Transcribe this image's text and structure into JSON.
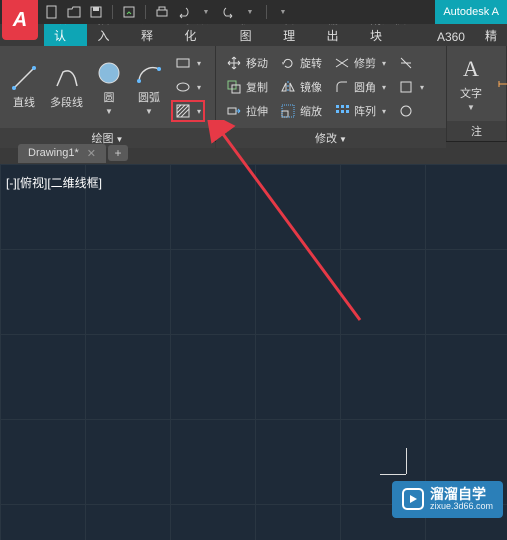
{
  "app": {
    "logo": "A",
    "title": "Autodesk A"
  },
  "tabs": [
    "默认",
    "插入",
    "注释",
    "参数化",
    "视图",
    "管理",
    "输出",
    "附加模块",
    "A360",
    "精"
  ],
  "activeTab": "默认",
  "panels": {
    "draw": {
      "title": "绘图",
      "tools": {
        "line": "直线",
        "polyline": "多段线",
        "circle": "圆",
        "arc": "圆弧"
      }
    },
    "modify": {
      "title": "修改",
      "tools": {
        "move": "移动",
        "rotate": "旋转",
        "trim": "修剪",
        "copy": "复制",
        "mirror": "镜像",
        "fillet": "圆角",
        "stretch": "拉伸",
        "scale": "缩放",
        "array": "阵列"
      }
    },
    "annotation": {
      "title": "注",
      "tools": {
        "text": "文字",
        "dim": "标"
      }
    }
  },
  "fileTab": {
    "name": "Drawing1*"
  },
  "viewport": {
    "label": "[-][俯视][二维线框]"
  },
  "watermark": {
    "main": "溜溜自学",
    "sub": "zixue.3d66.com"
  }
}
